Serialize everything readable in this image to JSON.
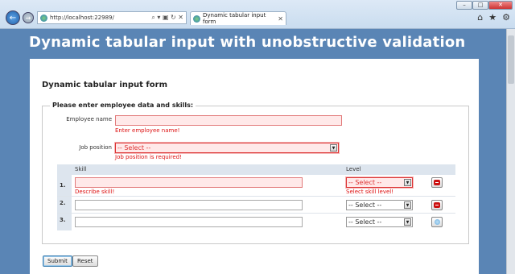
{
  "browser": {
    "url": "http://localhost:22989/",
    "tab_title": "Dynamic tabular input form",
    "address_controls": "⌕ ▾ ▣ ↻ ✕",
    "tab_close": "✕",
    "window_buttons": {
      "minimize": "–",
      "maximize": "□",
      "close": "✕"
    },
    "tools": {
      "home": "⌂",
      "favorites": "★",
      "settings": "⚙"
    }
  },
  "page": {
    "title": "Dynamic tabular input with unobstructive validation",
    "form_heading": "Dynamic tabular input form",
    "legend": "Please enter employee data and skills:"
  },
  "employee": {
    "name_label": "Employee name",
    "name_value": "",
    "name_error": "Enter employee name!",
    "position_label": "Job position",
    "position_selected": "-- Select --",
    "position_error": "Job position is required!"
  },
  "skills_table": {
    "headers": {
      "skill": "Skill",
      "level": "Level"
    },
    "rows": [
      {
        "num": "1.",
        "skill": "",
        "skill_error": "Describe skill!",
        "level": "-- Select --",
        "level_error": "Select skill level!"
      },
      {
        "num": "2.",
        "skill": "",
        "level": "-- Select --"
      },
      {
        "num": "3.",
        "skill": "",
        "level": "-- Select --"
      }
    ]
  },
  "buttons": {
    "submit": "Submit",
    "reset": "Reset"
  }
}
